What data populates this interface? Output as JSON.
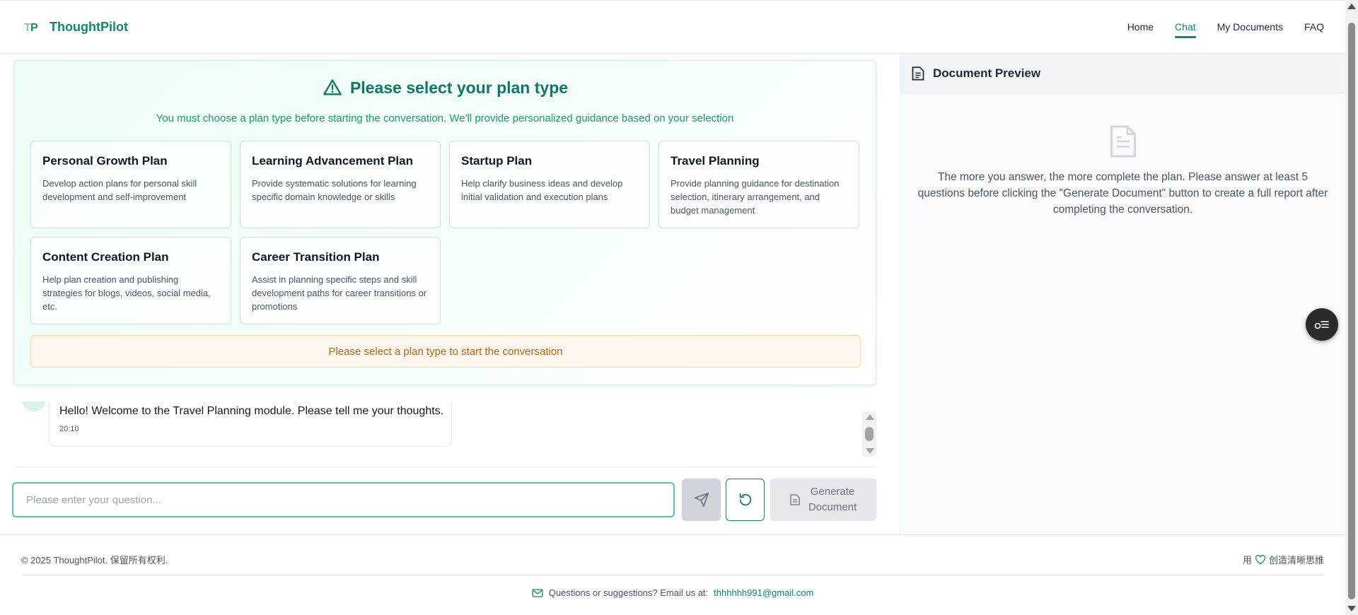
{
  "header": {
    "brand_name": "ThoughtPilot",
    "nav": [
      {
        "label": "Home",
        "active": false
      },
      {
        "label": "Chat",
        "active": true
      },
      {
        "label": "My Documents",
        "active": false
      },
      {
        "label": "FAQ",
        "active": false
      }
    ]
  },
  "plan_select": {
    "title": "Please select your plan type",
    "subtitle": "You must choose a plan type before starting the conversation. We'll provide personalized guidance based on your selection",
    "options": [
      {
        "title": "Personal Growth Plan",
        "desc": "Develop action plans for personal skill development and self-improvement"
      },
      {
        "title": "Learning Advancement Plan",
        "desc": "Provide systematic solutions for learning specific domain knowledge or skills"
      },
      {
        "title": "Startup Plan",
        "desc": "Help clarify business ideas and develop initial validation and execution plans"
      },
      {
        "title": "Travel Planning",
        "desc": "Provide planning guidance for destination selection, itinerary arrangement, and budget management"
      },
      {
        "title": "Content Creation Plan",
        "desc": "Help plan creation and publishing strategies for blogs, videos, social media, etc."
      },
      {
        "title": "Career Transition Plan",
        "desc": "Assist in planning specific steps and skill development paths for career transitions or promotions"
      }
    ],
    "warning": "Please select a plan type to start the conversation"
  },
  "chat": {
    "message": "Hello! Welcome to the Travel Planning module. Please tell me your thoughts.",
    "time": "20:10",
    "input_placeholder": "Please enter your question...",
    "input_value": "",
    "generate_label_line1": "Generate",
    "generate_label_line2": "Document"
  },
  "preview": {
    "title": "Document Preview",
    "empty_text": "The more you answer, the more complete the plan. Please answer at least 5 questions before clicking the \"Generate Document\" button to create a full report after completing the conversation."
  },
  "footer": {
    "copyright": "© 2025 ThoughtPilot. 保留所有权利.",
    "made_prefix": "用",
    "made_suffix": "创造清晰思维",
    "contact_text": "Questions or suggestions? Email us at:",
    "email": "thhhhhh991@gmail.com"
  },
  "colors": {
    "brand": "#0f8a6a",
    "warning_text": "#c2610c",
    "input_border": "#59c7a0"
  },
  "icons": [
    "logo-icon",
    "warning-triangle-icon",
    "send-icon",
    "refresh-icon",
    "document-icon",
    "document-large-icon",
    "toc-toggle-icon",
    "heart-icon",
    "mail-icon"
  ]
}
